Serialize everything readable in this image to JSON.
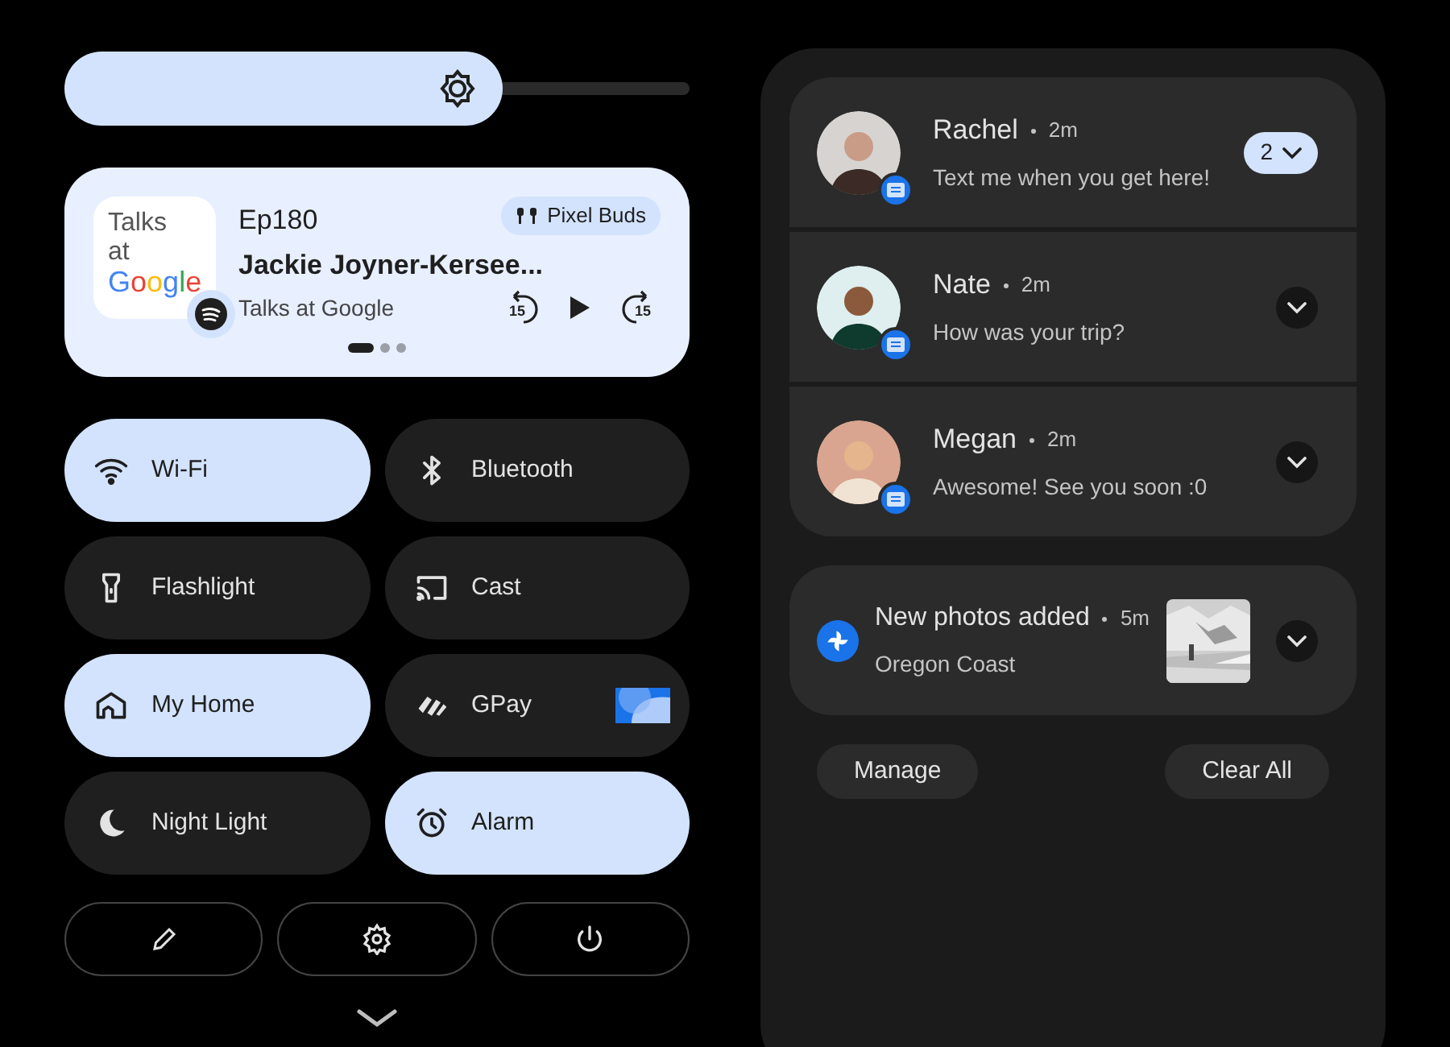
{
  "brightness": {
    "level": 0.7
  },
  "media": {
    "art_lines": [
      "Talks",
      "at",
      "Google"
    ],
    "episode": "Ep180",
    "title": "Jackie Joyner-Kersee...",
    "source": "Talks at Google",
    "output": "Pixel Buds",
    "skip_back": "15",
    "skip_forward": "15",
    "pages": [
      {
        "selected": true
      },
      {
        "selected": false
      },
      {
        "selected": false
      }
    ]
  },
  "tiles": [
    {
      "label": "Wi-Fi",
      "on": true
    },
    {
      "label": "Bluetooth",
      "on": false
    },
    {
      "label": "Flashlight",
      "on": false
    },
    {
      "label": "Cast",
      "on": false
    },
    {
      "label": "My Home",
      "on": true
    },
    {
      "label": "GPay",
      "on": false
    },
    {
      "label": "Night Light",
      "on": false
    },
    {
      "label": "Alarm",
      "on": true
    }
  ],
  "conversations": [
    {
      "name": "Rachel",
      "time": "2m",
      "message": "Text me when you get here!",
      "count": "2"
    },
    {
      "name": "Nate",
      "time": "2m",
      "message": "How was your trip?"
    },
    {
      "name": "Megan",
      "time": "2m",
      "message": "Awesome! See you soon :0"
    }
  ],
  "photos_notification": {
    "title": "New photos added",
    "time": "5m",
    "subtitle": "Oregon Coast"
  },
  "actions": [
    "Manage",
    "Clear All"
  ]
}
